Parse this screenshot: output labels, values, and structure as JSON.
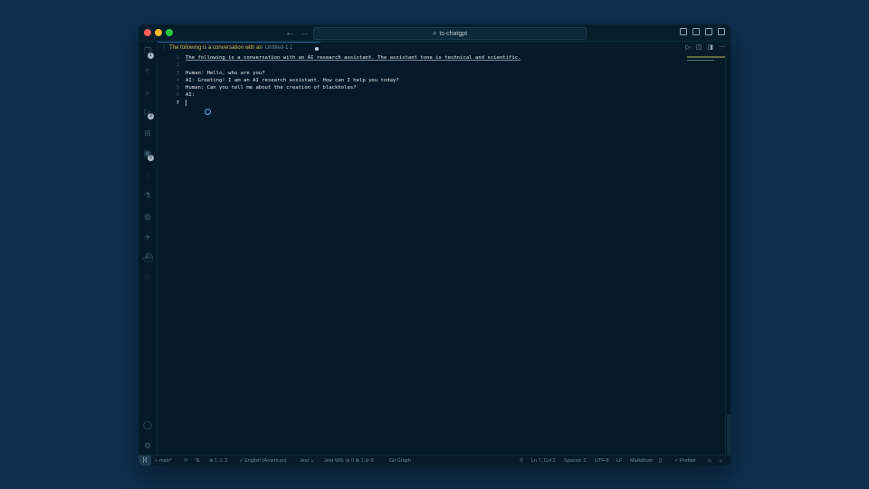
{
  "titlebar": {
    "search_text": "ts-chatgpt",
    "back_arrow": "←",
    "forward_arrow": "→"
  },
  "tab": {
    "title": "The following is a conversation with an",
    "meta": "Untitled-1 1"
  },
  "editor": {
    "line_numbers": [
      "1",
      "2",
      "3",
      "4",
      "5",
      "6",
      "7"
    ],
    "lines": [
      "The following is a conversation with an AI research assistant. The assistant tone is technical and scientific.",
      "",
      "Human: Hello, who are you?",
      "AI: Greeting! I am an AI research assistant. How can I help you today?",
      "Human: Can you tell me about the creation of blackholes?",
      "AI:",
      ""
    ],
    "current_line": 7
  },
  "activity_badges": [
    "1",
    "3",
    "5"
  ],
  "status_bar": {
    "branch": "main*",
    "problems": "⊗ 1 ⚠ 3",
    "language_tool": "English (American)",
    "jest": "Jest",
    "jest_ws": "Jest-WS: ⊘ 0 ⊗ 1 ⊘ 0",
    "git_graph": "Git Graph",
    "cursor_position": "Ln 7, Col 1",
    "indent": "Spaces: 2",
    "encoding": "UTF-8",
    "eol": "LF",
    "language": "Markdown",
    "prettier": "✓ Prettier"
  },
  "colors": {
    "page_background": "#0e2f4d",
    "editor_background": "#051a28",
    "tab_title": "#d6b85a",
    "text": "#e4e9ec"
  },
  "icons": [
    "explorer-icon",
    "search-icon",
    "source-control-icon",
    "run-debug-icon",
    "extensions-icon",
    "remote-icon",
    "testing-icon",
    "github-icon",
    "bird-icon",
    "docker-icon",
    "heart-icon",
    "account-icon",
    "settings-gear-icon"
  ]
}
